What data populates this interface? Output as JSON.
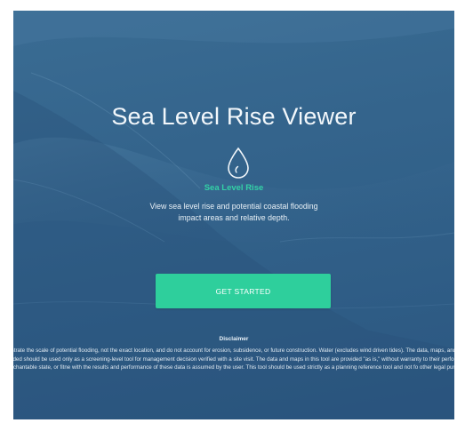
{
  "hero": {
    "title": "Sea Level Rise Viewer",
    "icon": "water-drop-icon",
    "subtitle": "Sea Level Rise",
    "description": "View sea level rise and potential coastal flooding impact areas and relative depth.",
    "cta_label": "GET STARTED"
  },
  "disclaimer": {
    "title": "Disclaimer",
    "text": "s tool illustrate the scale of potential flooding, not the exact location, and do not account for erosion, subsidence, or future construction. Water (excludes wind driven tides). The data, maps, and information provided should be used only as a screening-level tool for management decision verified with a site visit. The data and maps in this tool are provided \"as is,\" without warranty to their performance, merchantable state, or fitne with the results and performance of these data is assumed by the user. This tool should be used strictly as a planning reference tool and not fo other legal purposes."
  },
  "colors": {
    "background": "#2f5d86",
    "accent": "#2ecf9c",
    "subtitle": "#33d1a6"
  }
}
